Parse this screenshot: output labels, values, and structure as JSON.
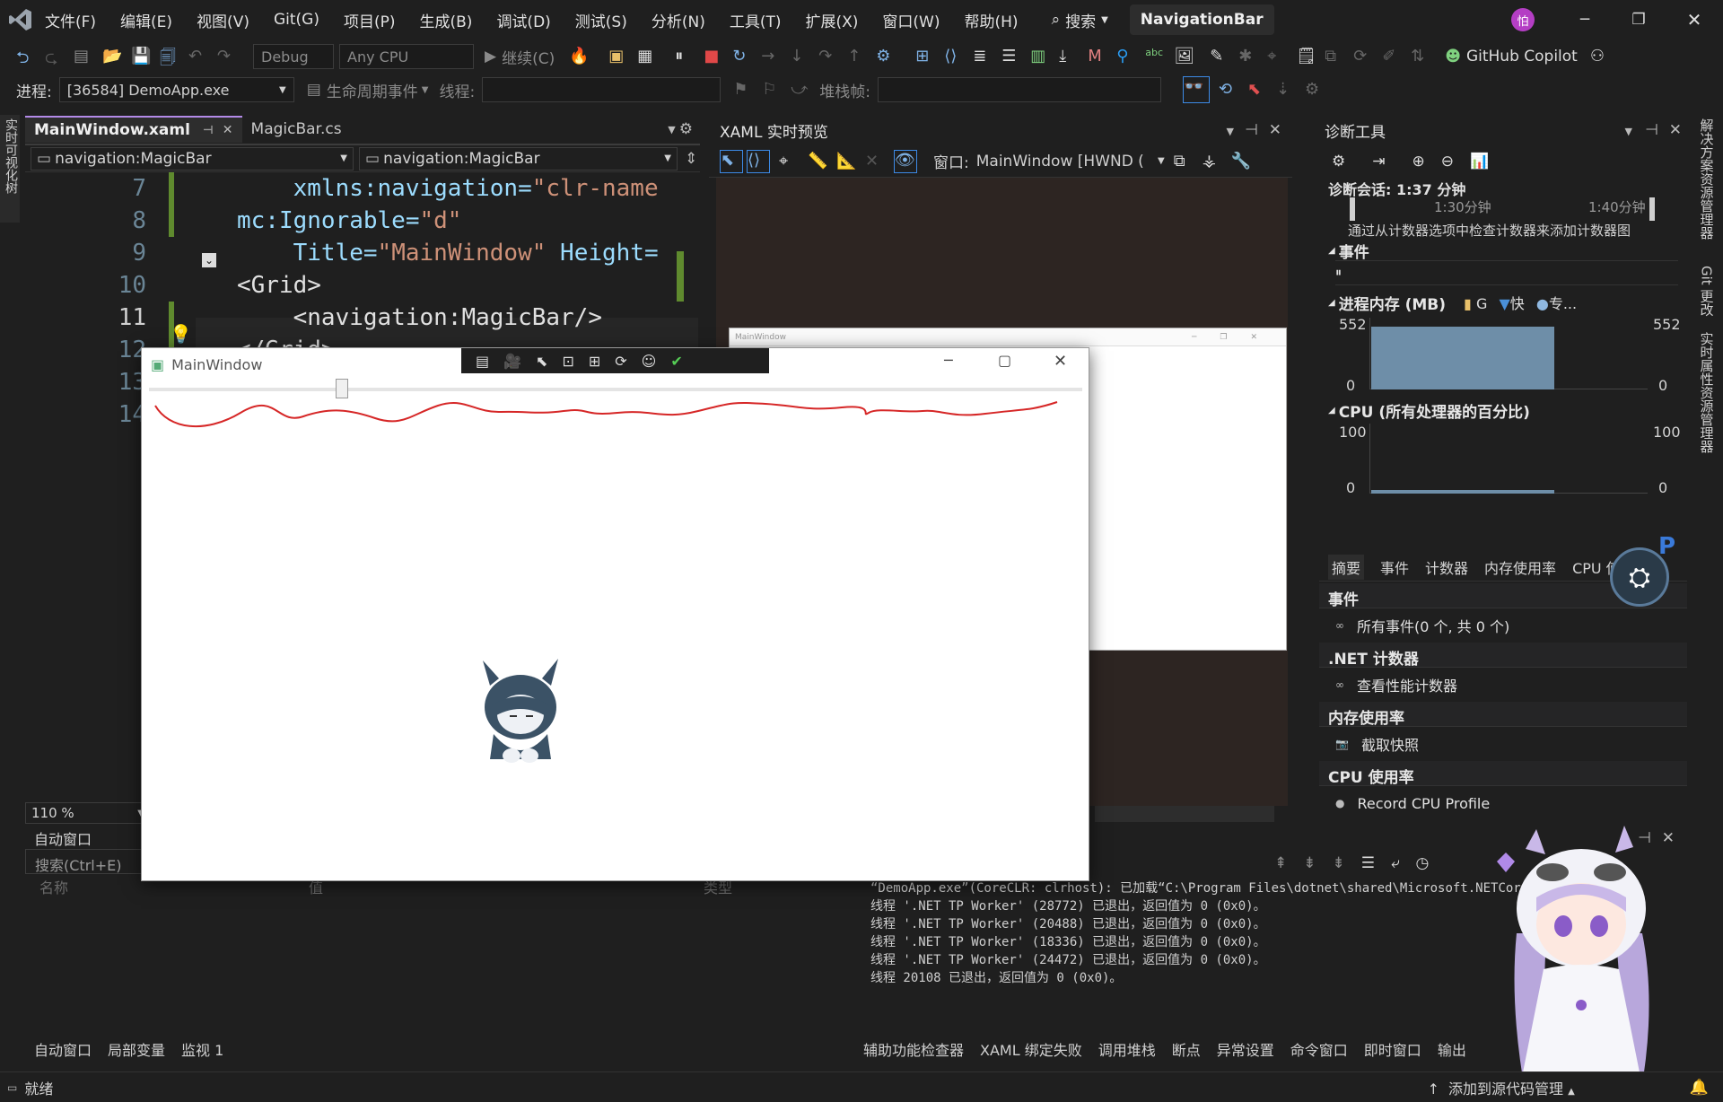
{
  "app": {
    "title": "NavigationBar",
    "avatar": "怕"
  },
  "menu": [
    "文件(F)",
    "编辑(E)",
    "视图(V)",
    "Git(G)",
    "项目(P)",
    "生成(B)",
    "调试(D)",
    "测试(S)",
    "分析(N)",
    "工具(T)",
    "扩展(X)",
    "窗口(W)",
    "帮助(H)"
  ],
  "search": {
    "label": "搜索"
  },
  "toolbar": {
    "config": "Debug",
    "platform": "Any CPU",
    "continue": "继续(C)",
    "copilot": "GitHub Copilot"
  },
  "toolbar2": {
    "process_label": "进程:",
    "process": "[36584] DemoApp.exe",
    "lifecycle": "生命周期事件",
    "thread_label": "线程:",
    "stack_label": "堆栈帧:"
  },
  "left_rail": "实时可视化树",
  "right_rail": [
    "解决方案资源管理器",
    "Git 更改",
    "实时属性资源管理器"
  ],
  "editor": {
    "tabs": [
      "MainWindow.xaml",
      "MagicBar.cs"
    ],
    "nav_left": "navigation:MagicBar",
    "nav_right": "navigation:MagicBar",
    "zoom": "110 %",
    "lines": [
      {
        "no": "7",
        "code": [
          {
            "t": "    xmlns:navigation=",
            "c": "at"
          },
          {
            "t": "\"clr-name",
            "c": "st"
          }
        ]
      },
      {
        "no": "8",
        "code": [
          {
            "t": "mc:Ignorable=",
            "c": "at"
          },
          {
            "t": "\"d\"",
            "c": "st"
          }
        ]
      },
      {
        "no": "9",
        "code": [
          {
            "t": "    Title=",
            "c": "at"
          },
          {
            "t": "\"MainWindow\"",
            "c": "st"
          },
          {
            "t": " Height=",
            "c": "at"
          }
        ]
      },
      {
        "no": "10",
        "code": [
          {
            "t": "<Grid>",
            "c": "el"
          }
        ]
      },
      {
        "no": "11",
        "code": [
          {
            "t": "    <navigation:MagicBar/>",
            "c": "el"
          }
        ]
      },
      {
        "no": "12",
        "code": [
          {
            "t": "</Grid>",
            "c": "el"
          }
        ]
      },
      {
        "no": "13",
        "code": []
      },
      {
        "no": "14",
        "code": []
      }
    ]
  },
  "xaml_preview": {
    "title": "XAML 实时预览",
    "window_label": "窗口:",
    "window_value": "MainWindow [HWND (",
    "inner_title": "MainWindow"
  },
  "main_window": {
    "title": "MainWindow",
    "slider_value": 0.2
  },
  "diagnostics": {
    "title": "诊断工具",
    "session": "诊断会话: 1:37 分钟",
    "t1": "1:30分钟",
    "t2": "1:40分钟",
    "hint": "通过从计数器选项中检查计数器来添加计数器图",
    "events_h": "事件",
    "memory_h": "进程内存 (MB)",
    "legend": [
      "G",
      "快",
      "专..."
    ],
    "mem_max": "552",
    "mem_min": "0",
    "cpu_h": "CPU (所有处理器的百分比)",
    "cpu_max": "100",
    "cpu_min": "0",
    "tabs": [
      "摘要",
      "事件",
      "计数器",
      "内存使用率",
      "CPU 使用率"
    ],
    "sections": [
      {
        "h": "事件",
        "item": "所有事件(0 个, 共 0 个)"
      },
      {
        "h": ".NET 计数器",
        "item": "查看性能计数器"
      },
      {
        "h": "内存使用率",
        "item": "截取快照"
      },
      {
        "h": "CPU 使用率",
        "item": "Record CPU Profile"
      }
    ]
  },
  "autos": {
    "title": "自动窗口",
    "search": "搜索(Ctrl+E)",
    "cols": [
      "名称",
      "值",
      "类型"
    ],
    "tabs": [
      "自动窗口",
      "局部变量",
      "监视 1"
    ]
  },
  "output": {
    "lines": [
      "“DemoApp.exe”(CoreCLR: clrhost): 已加载“C:\\Program Files\\dotnet\\shared\\Microsoft.NETCor",
      "线程 '.NET TP Worker' (28772) 已退出，返回值为 0 (0x0)。",
      "线程 '.NET TP Worker' (20488) 已退出，返回值为 0 (0x0)。",
      "线程 '.NET TP Worker' (18336) 已退出，返回值为 0 (0x0)。",
      "线程 '.NET TP Worker' (24472) 已退出，返回值为 0 (0x0)。",
      "线程 20108 已退出，返回值为 0 (0x0)。"
    ],
    "tabs": [
      "辅助功能检查器",
      "XAML 绑定失败",
      "调用堆栈",
      "断点",
      "异常设置",
      "命令窗口",
      "即时窗口",
      "输出"
    ]
  },
  "status": {
    "ready": "就绪",
    "source": "添加到源代码管理"
  }
}
